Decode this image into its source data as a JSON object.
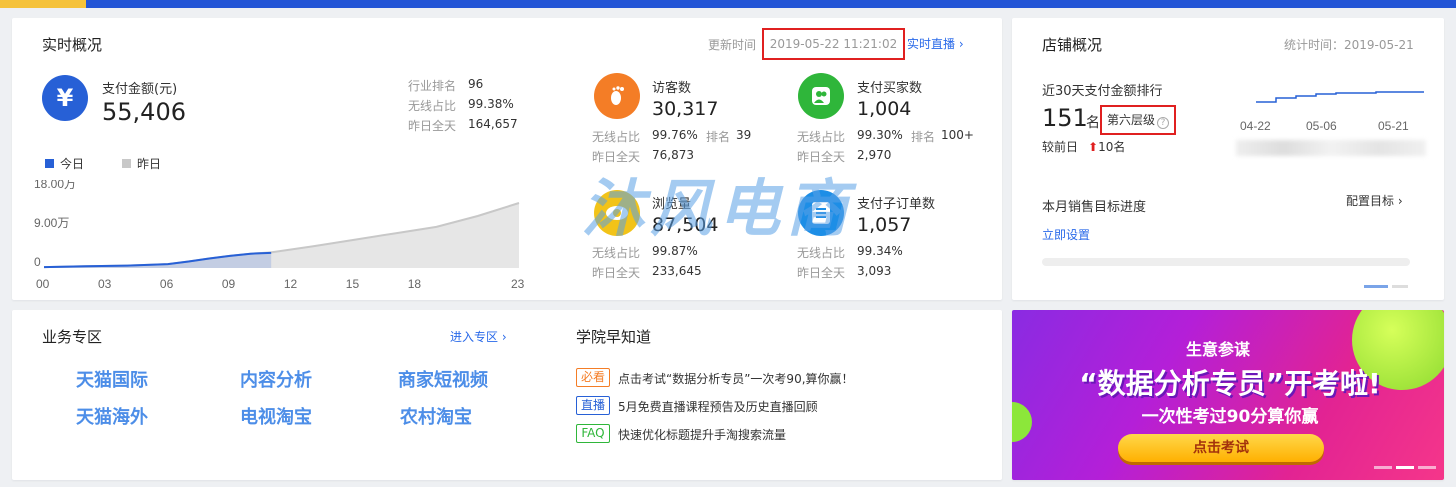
{
  "realtime": {
    "title": "实时概况",
    "update_label": "更新时间",
    "update_time": "2019-05-22 11:21:02",
    "live_link": "实时直播 ›",
    "pay": {
      "icon": "¥",
      "label": "支付金额(元)",
      "value": "55,406",
      "stats": [
        {
          "label": "行业排名",
          "value": "96"
        },
        {
          "label": "无线占比",
          "value": "99.38%"
        },
        {
          "label": "昨日全天",
          "value": "164,657"
        }
      ]
    },
    "legend": {
      "today": "今日",
      "yesterday": "昨日"
    },
    "metrics": [
      {
        "icon": "footprint-icon",
        "color": "#f47d26",
        "label": "访客数",
        "value": "30,317",
        "sub1_label": "无线占比",
        "sub1_value": "99.76%",
        "extra_label": "排名",
        "extra_value": "39",
        "sub2_label": "昨日全天",
        "sub2_value": "76,873"
      },
      {
        "icon": "buyers-icon",
        "color": "#2fb63a",
        "label": "支付买家数",
        "value": "1,004",
        "sub1_label": "无线占比",
        "sub1_value": "99.30%",
        "extra_label": "排名",
        "extra_value": "100+",
        "sub2_label": "昨日全天",
        "sub2_value": "2,970"
      },
      {
        "icon": "eye-icon",
        "color": "#f2c318",
        "label": "浏览量",
        "value": "87,504",
        "sub1_label": "无线占比",
        "sub1_value": "99.87%",
        "extra_label": "",
        "extra_value": "",
        "sub2_label": "昨日全天",
        "sub2_value": "233,645"
      },
      {
        "icon": "order-icon",
        "color": "#1d8ee6",
        "label": "支付子订单数",
        "value": "1,057",
        "sub1_label": "无线占比",
        "sub1_value": "99.34%",
        "extra_label": "",
        "extra_value": "",
        "sub2_label": "昨日全天",
        "sub2_value": "3,093"
      }
    ],
    "watermark": "沐风电商"
  },
  "chart_data": {
    "type": "area",
    "x_ticks": [
      "00",
      "03",
      "06",
      "09",
      "12",
      "15",
      "18",
      "23"
    ],
    "y_ticks": [
      "18.00万",
      "9.00万",
      "0"
    ],
    "ylim": [
      0,
      180000
    ],
    "series": [
      {
        "name": "今日",
        "color": "#2760d6",
        "x": [
          0,
          2,
          4,
          6,
          7,
          8,
          9,
          10,
          11
        ],
        "values": [
          2000,
          4000,
          5500,
          9000,
          15000,
          22000,
          28000,
          33000,
          35000
        ]
      },
      {
        "name": "昨日",
        "color": "#c8c8c8",
        "x": [
          0,
          2,
          4,
          6,
          7,
          8,
          9,
          10,
          11,
          13,
          15,
          17,
          19,
          21,
          23
        ],
        "values": [
          2000,
          4000,
          5500,
          9000,
          15000,
          22000,
          28000,
          33000,
          36000,
          50000,
          65000,
          80000,
          95000,
          120000,
          150000
        ]
      }
    ]
  },
  "shop": {
    "title": "店铺概况",
    "stat_time": "统计时间：2019-05-21",
    "rank_label": "近30天支付金额排行",
    "rank_value": "151",
    "rank_unit": "名",
    "level": "第六层级",
    "prev_label": "较前日",
    "prev_arrow": "⬆",
    "prev_value": "10名",
    "trend_ticks": [
      "04-22",
      "05-06",
      "05-21"
    ],
    "month_label": "本月销售目标进度",
    "config_target": "配置目标 ›",
    "set_now": "立即设置"
  },
  "biz": {
    "title": "业务专区",
    "enter": "进入专区 ›",
    "links": [
      "天猫国际",
      "内容分析",
      "商家短视频",
      "天猫海外",
      "电视淘宝",
      "农村淘宝"
    ]
  },
  "academy": {
    "title": "学院早知道",
    "items": [
      {
        "tag": "必看",
        "tag_color": "#f47d26",
        "text": "点击考试“数据分析专员”一次考90,算你赢！"
      },
      {
        "tag": "直播",
        "tag_color": "#2760d6",
        "text": "5月免费直播课程预告及历史直播回顾"
      },
      {
        "tag": "FAQ",
        "tag_color": "#2fb63a",
        "text": "快速优化标题提升手淘搜索流量"
      }
    ]
  },
  "banner": {
    "tag": "生意参谋",
    "headline": "“数据分析专员”开考啦!",
    "subline": "一次性考过90分算你赢",
    "button": "点击考试"
  }
}
